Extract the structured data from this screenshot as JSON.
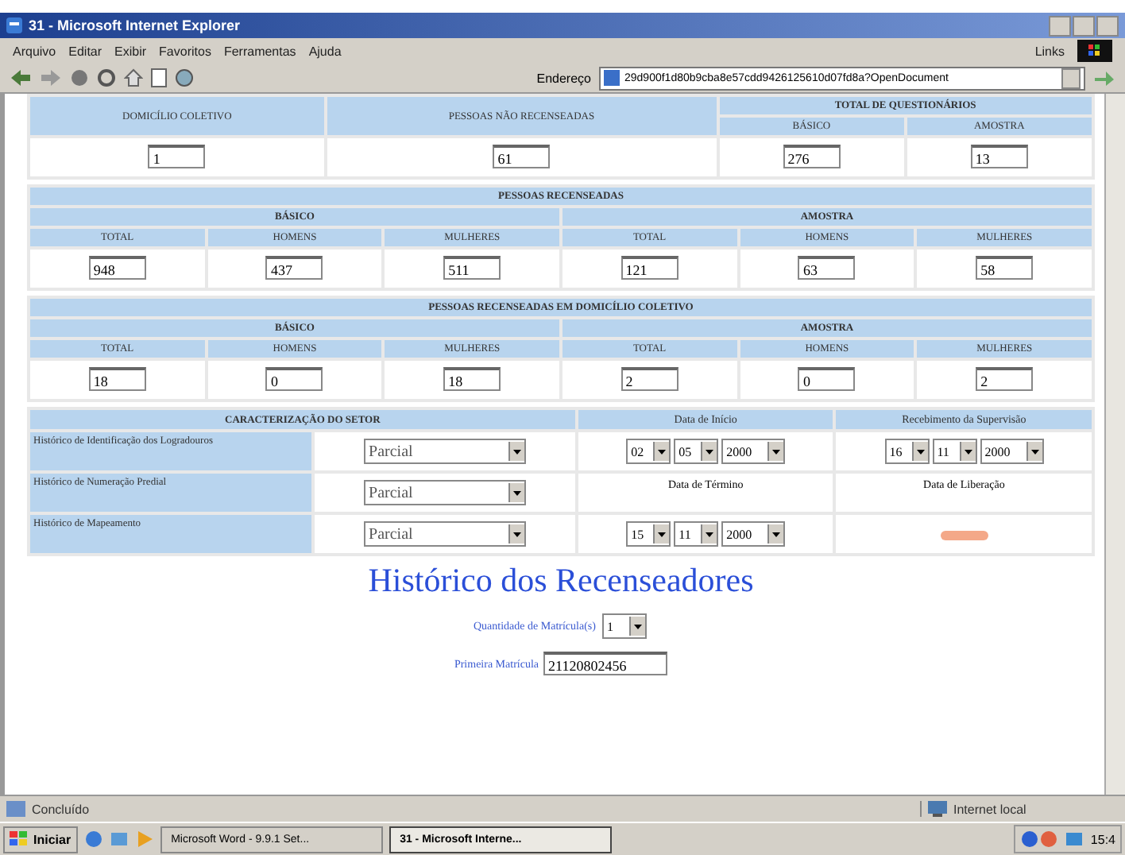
{
  "window": {
    "title": "31 - Microsoft Internet Explorer"
  },
  "menu": [
    "Arquivo",
    "Editar",
    "Exibir",
    "Favoritos",
    "Ferramentas",
    "Ajuda"
  ],
  "links_label": "Links",
  "address_label": "Endereço",
  "address": "29d900f1d80b9cba8e57cdd9426125610d07fd8a?OpenDocument",
  "top_section": {
    "columns": [
      {
        "label": "DOMICÍLIO COLETIVO",
        "value": "1"
      },
      {
        "label": "PESSOAS NÃO RECENSEADAS",
        "value": "61"
      }
    ],
    "group": {
      "label": "TOTAL DE QUESTIONÁRIOS",
      "columns": [
        {
          "label": "BÁSICO",
          "value": "276"
        },
        {
          "label": "AMOSTRA",
          "value": "13"
        }
      ]
    }
  },
  "sections": [
    {
      "title": "PESSOAS RECENSEADAS",
      "groups": [
        {
          "label": "BÁSICO",
          "columns": [
            {
              "label": "TOTAL",
              "value": "948"
            },
            {
              "label": "HOMENS",
              "value": "437"
            },
            {
              "label": "MULHERES",
              "value": "511"
            }
          ]
        },
        {
          "label": "AMOSTRA",
          "columns": [
            {
              "label": "TOTAL",
              "value": "121"
            },
            {
              "label": "HOMENS",
              "value": "63"
            },
            {
              "label": "MULHERES",
              "value": "58"
            }
          ]
        }
      ]
    },
    {
      "title": "PESSOAS RECENSEADAS EM DOMICÍLIO COLETIVO",
      "groups": [
        {
          "label": "BÁSICO",
          "columns": [
            {
              "label": "TOTAL",
              "value": "18"
            },
            {
              "label": "HOMENS",
              "value": "0"
            },
            {
              "label": "MULHERES",
              "value": "18"
            }
          ]
        },
        {
          "label": "AMOSTRA",
          "columns": [
            {
              "label": "TOTAL",
              "value": "2"
            },
            {
              "label": "HOMENS",
              "value": "0"
            },
            {
              "label": "MULHERES",
              "value": "2"
            }
          ]
        }
      ]
    }
  ],
  "characterization": {
    "title": "CARACTERIZAÇÃO DO SETOR",
    "headers": [
      "Data de Início",
      "Recebimento da Supervisão"
    ],
    "rows": [
      {
        "label": "Histórico de Identificação dos Logradouros",
        "value": "Parcial",
        "cells": [
          {
            "kind": "date",
            "day": "02",
            "month": "05",
            "year": "2000"
          },
          {
            "kind": "date",
            "day": "16",
            "month": "11",
            "year": "2000"
          }
        ]
      },
      {
        "label": "Histórico de Numeração Predial",
        "value": "Parcial",
        "cells": [
          {
            "kind": "label",
            "text": "Data de Término"
          },
          {
            "kind": "label",
            "text": "Data de Liberação"
          }
        ]
      },
      {
        "label": "Histórico de Mapeamento",
        "value": "Parcial",
        "cells": [
          {
            "kind": "date",
            "day": "15",
            "month": "11",
            "year": "2000"
          },
          {
            "kind": "mark"
          }
        ]
      }
    ]
  },
  "history": {
    "title": "Histórico dos Recenseadores",
    "quantity_label": "Quantidade de Matrícula(s)",
    "quantity": "1",
    "first_label": "Primeira Matrícula",
    "first_value": "21120802456"
  },
  "status_bar": {
    "text": "Concluído",
    "zone": "Internet local"
  },
  "taskbar": {
    "start": "Iniciar",
    "tasks": [
      {
        "label": "Microsoft Word - 9.9.1 Set...",
        "selected": false
      },
      {
        "label": "31 - Microsoft Interne...",
        "selected": true
      }
    ],
    "clock": "15:4"
  }
}
